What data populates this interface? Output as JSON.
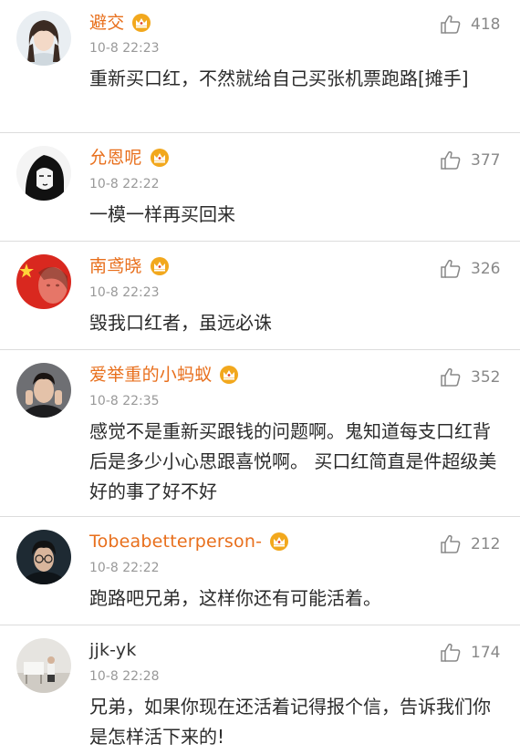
{
  "comments": [
    {
      "username": "避交",
      "verified_badge": "crown-badge-icon",
      "timestamp": "10-8 22:23",
      "text": "重新买口红，不然就给自己买张机票跑路[摊手]",
      "likes": "418",
      "avatar": "girl-portrait-avatar"
    },
    {
      "username": "允恩呢",
      "verified_badge": "crown-badge-icon",
      "timestamp": "10-8 22:22",
      "text": "一模一样再买回来",
      "likes": "377",
      "avatar": "sketch-portrait-avatar"
    },
    {
      "username": "南鸢晓",
      "verified_badge": "crown-badge-icon",
      "timestamp": "10-8 22:23",
      "text": "毁我口红者，虽远必诛",
      "likes": "326",
      "avatar": "flag-face-avatar"
    },
    {
      "username": "爱举重的小蚂蚁",
      "verified_badge": "crown-badge-icon",
      "timestamp": "10-8 22:35",
      "text": "感觉不是重新买跟钱的问题啊。鬼知道每支口红背后是多少小心思跟喜悦啊。 买口红简直是件超级美好的事了好不好",
      "likes": "352",
      "avatar": "man-portrait-avatar"
    },
    {
      "username": "Tobeabetterperson-",
      "verified_badge": "crown-badge-icon",
      "timestamp": "10-8 22:22",
      "text": "跑路吧兄弟，这样你还有可能活着。",
      "likes": "212",
      "avatar": "boy-glasses-avatar"
    },
    {
      "username": "jjk-yk",
      "verified_badge": "",
      "timestamp": "10-8 22:28",
      "text": "兄弟，如果你现在还活着记得报个信，告诉我们你是怎样活下来的!",
      "likes": "174",
      "avatar": "piano-room-avatar"
    }
  ],
  "colors": {
    "username": "#e86f1c",
    "timestamp": "#999999",
    "text": "#2b2b2b",
    "like": "#888888",
    "divider": "#dcdcdc",
    "badge": "#f2a81d"
  }
}
